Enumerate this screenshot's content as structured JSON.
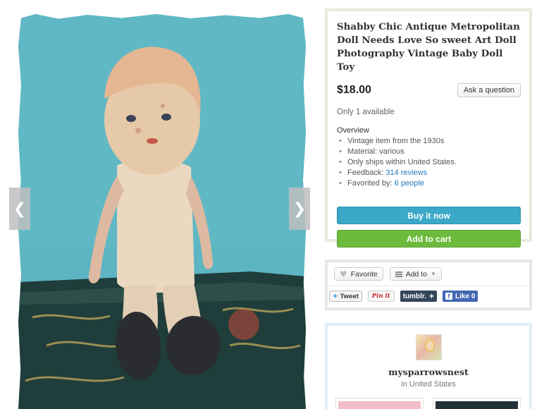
{
  "listing": {
    "title": "Shabby Chic Antique Metropolitan Doll Needs Love So sweet Art Doll Photography Vintage Baby Doll Toy",
    "price": "$18.00",
    "ask_button": "Ask a question",
    "availability": "Only 1 available",
    "overview_heading": "Overview",
    "facts": {
      "age": "Vintage item from the 1930s",
      "material": "Material: various",
      "shipping": "Only ships within United States.",
      "feedback_label": "Feedback: ",
      "feedback_link": "314 reviews",
      "favorited_label": "Favorited by: ",
      "favorited_link": "6 people"
    },
    "buy_button": "Buy it now",
    "cart_button": "Add to cart"
  },
  "gallery": {
    "prev_icon": "❮",
    "next_icon": "❯"
  },
  "social": {
    "favorite_label": "Favorite",
    "addto_label": "Add to",
    "tweet_label": "Tweet",
    "pin_label": "Pin it",
    "tumblr_label": "tumblr.",
    "like_label": "Like 0"
  },
  "shop": {
    "name": "mysparrowsnest",
    "location": "in United States"
  },
  "colors": {
    "buy": "#3ba8c8",
    "cart": "#6dbb3e",
    "link": "#2878b8"
  }
}
